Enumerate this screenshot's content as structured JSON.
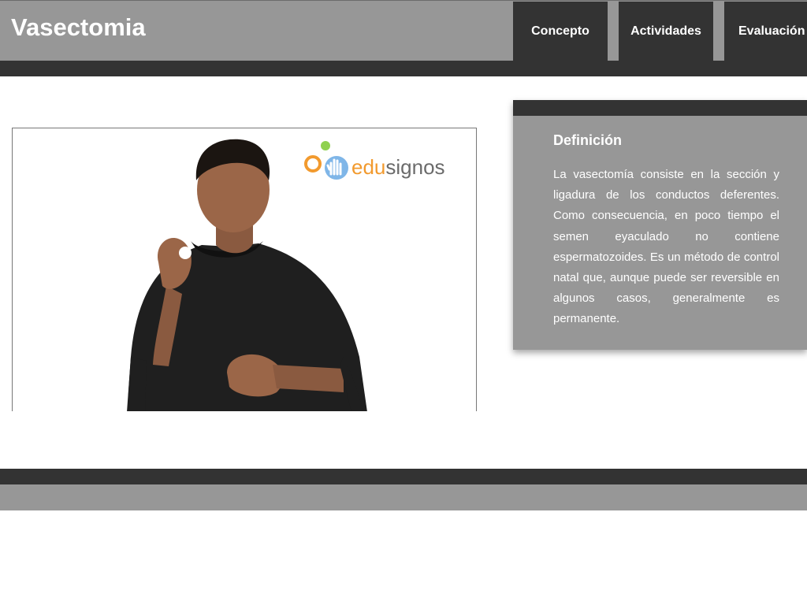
{
  "header": {
    "title": "Vasectomia",
    "nav": [
      {
        "label": "Concepto"
      },
      {
        "label": "Actividades"
      },
      {
        "label": "Evaluación"
      }
    ]
  },
  "video": {
    "logo_text": "edusignos"
  },
  "definition": {
    "title": "Definición",
    "body": "La vasectomía consiste en la sección y ligadura de los conductos deferentes. Como consecuencia, en poco tiempo el semen eyaculado no contiene espermatozoides. Es un método de control natal que, aunque puede ser reversible en algunos casos, generalmente es permanente."
  },
  "colors": {
    "dark": "#333333",
    "gray": "#979797",
    "logo_edu": "#f29a2e",
    "logo_signos": "#6b6b6b"
  }
}
